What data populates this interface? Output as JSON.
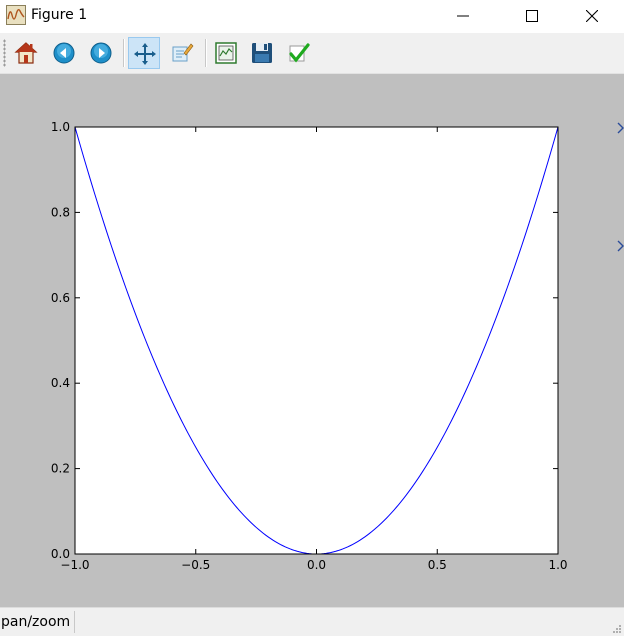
{
  "window": {
    "title": "Figure 1"
  },
  "toolbar": {
    "items": [
      {
        "name": "home-icon",
        "tooltip": "Home"
      },
      {
        "name": "back-icon",
        "tooltip": "Back"
      },
      {
        "name": "forward-icon",
        "tooltip": "Forward"
      },
      {
        "name": "pan-icon",
        "tooltip": "Pan",
        "active": true
      },
      {
        "name": "zoom-icon",
        "tooltip": "Zoom"
      },
      {
        "name": "subplots-icon",
        "tooltip": "Subplots"
      },
      {
        "name": "save-icon",
        "tooltip": "Save"
      },
      {
        "name": "check-icon",
        "tooltip": "Edit"
      }
    ]
  },
  "status": {
    "text": "pan/zoom"
  },
  "colors": {
    "canvas_bg": "#bfbfbf",
    "line": "#0000ff",
    "toolbar_bg": "#f0f0f0",
    "active_tool": "#cce4f7"
  },
  "chart_data": {
    "type": "line",
    "title": "",
    "xlabel": "",
    "ylabel": "",
    "xlim": [
      -1.0,
      1.0
    ],
    "ylim": [
      0.0,
      1.0
    ],
    "xticks": [
      -1.0,
      -0.5,
      0.0,
      0.5,
      1.0
    ],
    "xtick_labels": [
      "−1.0",
      "−0.5",
      "0.0",
      "0.5",
      "1.0"
    ],
    "yticks": [
      0.0,
      0.2,
      0.4,
      0.6,
      0.8,
      1.0
    ],
    "ytick_labels": [
      "0.0",
      "0.2",
      "0.4",
      "0.6",
      "0.8",
      "1.0"
    ],
    "grid": false,
    "series": [
      {
        "color": "#0000ff",
        "x": [
          -1.0,
          -0.9,
          -0.8,
          -0.7,
          -0.6,
          -0.5,
          -0.4,
          -0.3,
          -0.2,
          -0.1,
          0.0,
          0.1,
          0.2,
          0.3,
          0.4,
          0.5,
          0.6,
          0.7,
          0.8,
          0.9,
          1.0
        ],
        "y": [
          1.0,
          0.81,
          0.64,
          0.49,
          0.36,
          0.25,
          0.16,
          0.09,
          0.04,
          0.01,
          0.0,
          0.01,
          0.04,
          0.09,
          0.16,
          0.25,
          0.36,
          0.49,
          0.64,
          0.81,
          1.0
        ]
      }
    ]
  }
}
